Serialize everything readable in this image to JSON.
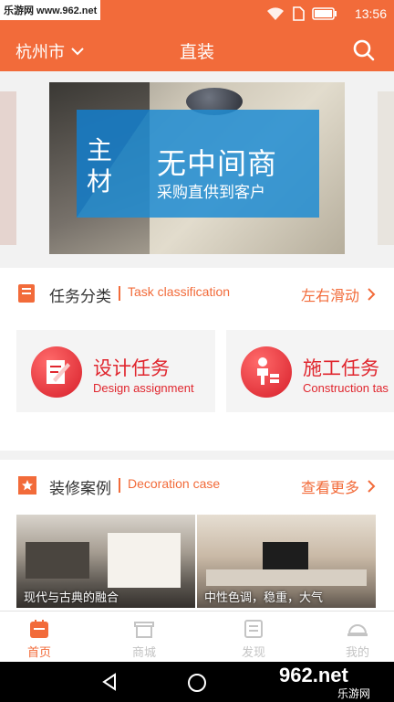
{
  "watermark": {
    "site": "乐游网 www.962.net"
  },
  "status": {
    "time": "13:56"
  },
  "header": {
    "city": "杭州市",
    "title": "直装"
  },
  "banner": {
    "tag": "主材",
    "headline": "无中间商",
    "subline": "采购直供到客户"
  },
  "tasks": {
    "title": "任务分类",
    "subtitle": "Task classification",
    "more": "左右滑动",
    "cards": [
      {
        "title": "设计任务",
        "subtitle": "Design assignment"
      },
      {
        "title": "施工任务",
        "subtitle": "Construction tas"
      }
    ]
  },
  "cases": {
    "title": "装修案例",
    "subtitle": "Decoration case",
    "more": "查看更多",
    "items": [
      {
        "caption": "现代与古典的融合"
      },
      {
        "caption": "中性色调，稳重，大气"
      }
    ]
  },
  "tabbar": {
    "items": [
      {
        "label": "首页",
        "active": true
      },
      {
        "label": "商城"
      },
      {
        "label": "发现"
      },
      {
        "label": "我的"
      }
    ]
  },
  "logo": {
    "text": "962.net",
    "brand": "乐游网"
  },
  "colors": {
    "accent": "#f26b3a",
    "red": "#e0262e"
  }
}
